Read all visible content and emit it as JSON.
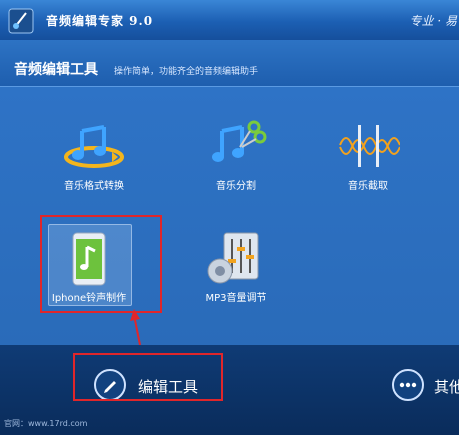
{
  "window": {
    "title": "音频编辑专家 9.0",
    "slogan": "专业 · 易"
  },
  "header": {
    "title": "音频编辑工具",
    "subtitle": "操作简单，功能齐全的音频编辑助手"
  },
  "tools": [
    {
      "label": "音乐格式转换",
      "icon": "music-convert-icon"
    },
    {
      "label": "音乐分割",
      "icon": "music-split-icon"
    },
    {
      "label": "音乐截取",
      "icon": "music-cut-icon"
    },
    {
      "label": "Iphone铃声制作",
      "icon": "iphone-ringtone-icon",
      "selected": true
    },
    {
      "label": "MP3音量调节",
      "icon": "mp3-volume-icon"
    }
  ],
  "bottom": {
    "edit_label": "编辑工具",
    "other_label": "其他",
    "footer": "官网：www.17rd.com"
  },
  "colors": {
    "highlight_box": "#e0262a",
    "background": "#2e73c6"
  }
}
